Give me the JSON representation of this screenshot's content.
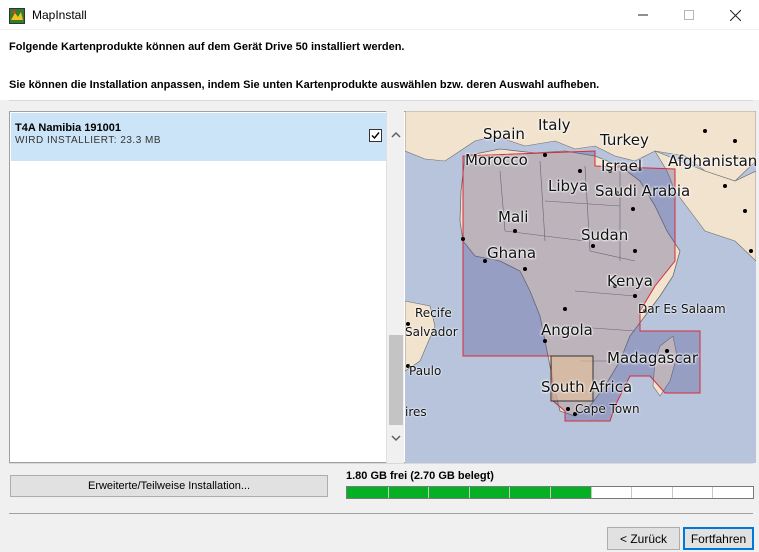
{
  "window": {
    "title": "MapInstall",
    "controls": {
      "minimize": "—",
      "maximize": "☐",
      "close": "✕"
    }
  },
  "header": {
    "line1": "Folgende Kartenprodukte können auf dem Gerät Drive 50 installiert werden.",
    "line2": "Sie können die Installation anpassen, indem Sie unten Kartenprodukte auswählen bzw. deren Auswahl aufheben."
  },
  "products": [
    {
      "name": "T4A Namibia 191001",
      "status": "WIRD INSTALLIERT: 23.3 MB",
      "checked": true
    }
  ],
  "map": {
    "labels": [
      "Spain",
      "Italy",
      "Turkey",
      "Morocco",
      "Israel",
      "Afghanistan",
      "Libya",
      "Saudi Arabia",
      "Mali",
      "Sudan",
      "Ghana",
      "Kenya",
      "Recife",
      "Salvador",
      "Dar Es Salaam",
      "Angola",
      "Madagascar",
      "Paulo",
      "South Africa",
      "ires",
      "Cape Town"
    ],
    "colors": {
      "ocean": "#b7c4dc",
      "land": "#f2e3cf",
      "selected_region": "#d92a3a"
    }
  },
  "advanced_button": "Erweiterte/Teilweise Installation...",
  "storage": {
    "label": "1.80 GB frei (2.70 GB belegt)",
    "used_fraction": 0.6,
    "fill_color": "#06b025"
  },
  "buttons": {
    "back": "< Zurück",
    "next": "Fortfahren"
  }
}
